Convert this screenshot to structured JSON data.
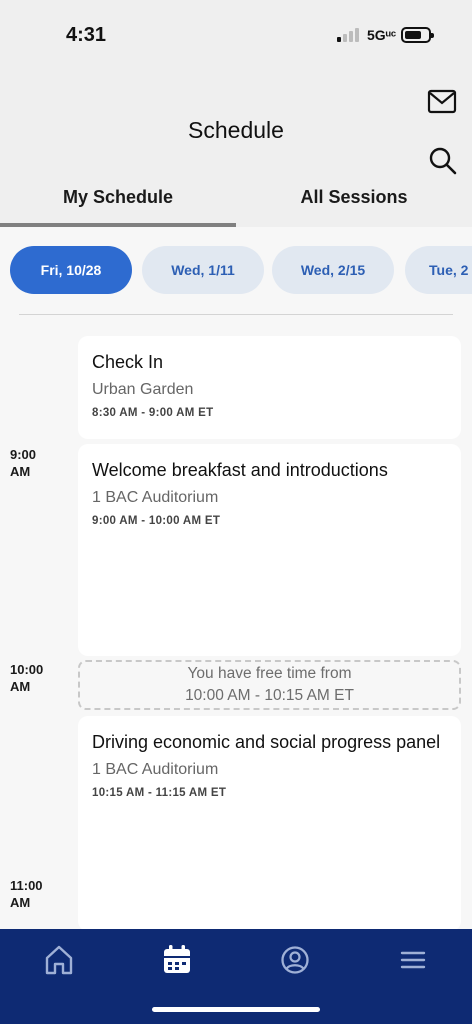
{
  "status_bar": {
    "time": "4:31",
    "network": "5Gᵘᶜ"
  },
  "header": {
    "title": "Schedule",
    "mail_icon": "mail-icon",
    "search_icon": "search-icon"
  },
  "tabs": [
    {
      "label": "My Schedule",
      "active": true
    },
    {
      "label": "All Sessions",
      "active": false
    }
  ],
  "dates": [
    {
      "label": "Fri, 10/28",
      "active": true
    },
    {
      "label": "Wed, 1/11",
      "active": false
    },
    {
      "label": "Wed, 2/15",
      "active": false
    },
    {
      "label": "Tue, 2",
      "active": false
    }
  ],
  "time_labels": [
    "9:00\nAM",
    "10:00\nAM",
    "11:00\nAM"
  ],
  "sessions": [
    {
      "title": "Check In",
      "location": "Urban Garden",
      "time": "8:30 AM - 9:00 AM ET"
    },
    {
      "title": "Welcome breakfast and introductions",
      "location": "1 BAC Auditorium",
      "time": "9:00 AM - 10:00 AM ET"
    },
    {
      "title": "Driving economic and social progress panel",
      "location": "1 BAC Auditorium",
      "time": "10:15 AM - 11:15 AM ET"
    }
  ],
  "free_time": {
    "line1": "You have free time from",
    "line2": "10:00 AM - 10:15 AM ET"
  },
  "bottom_nav": [
    {
      "icon": "home-icon"
    },
    {
      "icon": "calendar-icon",
      "active": true
    },
    {
      "icon": "profile-icon"
    },
    {
      "icon": "menu-icon"
    }
  ],
  "colors": {
    "accent": "#2e6bd0",
    "chip_bg": "#e1e8f1",
    "nav_bg": "#0e2a73"
  }
}
